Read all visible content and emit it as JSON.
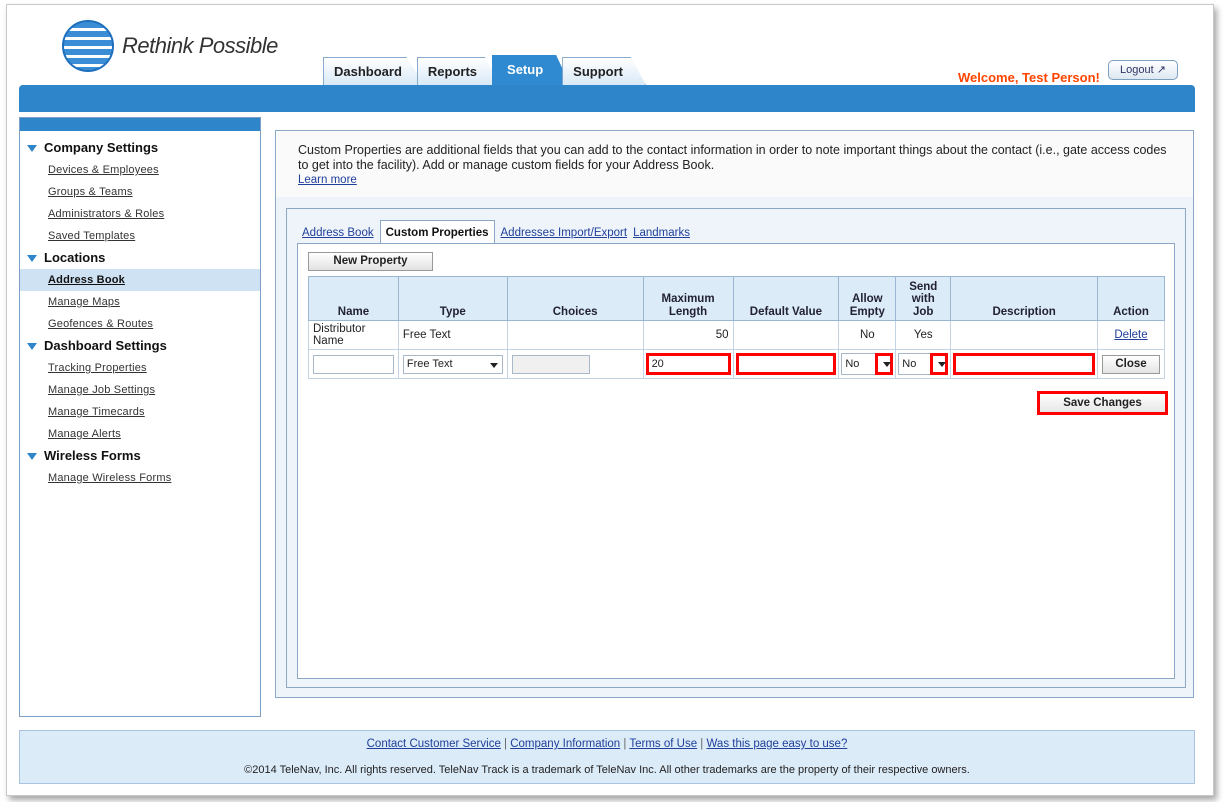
{
  "brand": {
    "logo_text": "Rethink Possible"
  },
  "nav": {
    "tabs": [
      {
        "label": "Dashboard"
      },
      {
        "label": "Reports"
      },
      {
        "label": "Setup"
      },
      {
        "label": "Support"
      }
    ],
    "welcome": "Welcome, Test Person!",
    "logout_label": "Logout"
  },
  "sidebar": {
    "sections": [
      {
        "title": "Company Settings",
        "items": [
          "Devices & Employees",
          "Groups & Teams",
          "Administrators & Roles",
          "Saved Templates"
        ]
      },
      {
        "title": "Locations",
        "items": [
          "Address Book",
          "Manage Maps",
          "Geofences & Routes"
        ]
      },
      {
        "title": "Dashboard Settings",
        "items": [
          "Tracking Properties",
          "Manage Job Settings",
          "Manage Timecards",
          "Manage Alerts"
        ]
      },
      {
        "title": "Wireless Forms",
        "items": [
          "Manage Wireless Forms"
        ]
      }
    ],
    "selected": "Address Book"
  },
  "intro": {
    "text": "Custom Properties are additional fields that you can add to the contact information in order to note important things about the contact (i.e., gate access codes to get into the facility). Add or manage custom fields for your Address Book.",
    "learn_more": "Learn more"
  },
  "subtabs": [
    {
      "label": "Address Book"
    },
    {
      "label": "Custom Properties"
    },
    {
      "label": "Addresses Import/Export"
    },
    {
      "label": "Landmarks"
    }
  ],
  "new_property_label": "New Property",
  "table": {
    "headers": [
      "Name",
      "Type",
      "Choices",
      "Maximum Length",
      "Default Value",
      "Allow Empty",
      "Send with Job",
      "Description",
      "Action"
    ],
    "rows": [
      {
        "name": "Distributor Name",
        "type": "Free Text",
        "choices": "",
        "max_length": "50",
        "default_value": "",
        "allow_empty": "No",
        "send_with_job": "Yes",
        "description": "",
        "action": "Delete"
      }
    ],
    "edit_row": {
      "name": "",
      "type": "Free Text",
      "choices": "",
      "max_length": "20",
      "default_value": "",
      "allow_empty": "No",
      "send_with_job": "No",
      "description": "",
      "action": "Close"
    }
  },
  "save_label": "Save Changes",
  "footer": {
    "links": [
      "Contact Customer Service",
      "Company Information",
      "Terms of Use",
      "Was this page easy to use?"
    ],
    "copyright": "©2014 TeleNav, Inc. All rights reserved. TeleNav Track is a trademark of TeleNav Inc. All other trademarks are the property of their respective owners."
  },
  "colors": {
    "accent": "#2f85c9",
    "highlight": "#ff0000",
    "welcome": "#ff4400"
  }
}
